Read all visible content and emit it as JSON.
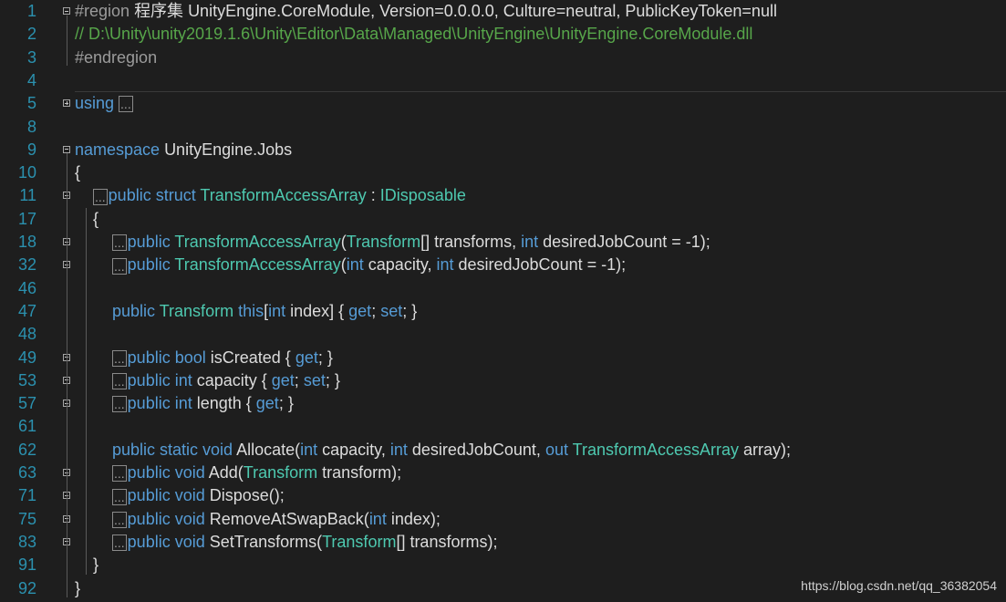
{
  "editor": {
    "lines": [
      {
        "n": "1",
        "fold": "minus",
        "indent": 0,
        "segs": [
          {
            "c": "pp",
            "t": "#region "
          },
          {
            "c": "tx",
            "t": "程序集 UnityEngine.CoreModule, Version=0.0.0.0, Culture=neutral, PublicKeyToken=null"
          }
        ]
      },
      {
        "n": "2",
        "indent": 0,
        "segs": [
          {
            "c": "cm",
            "t": "// D:\\Unity\\unity2019.1.6\\Unity\\Editor\\Data\\Managed\\UnityEngine\\UnityEngine.CoreModule.dll"
          }
        ]
      },
      {
        "n": "3",
        "indent": 0,
        "segs": [
          {
            "c": "pp",
            "t": "#endregion"
          }
        ]
      },
      {
        "n": "4",
        "indent": 0,
        "segs": []
      },
      {
        "n": "5",
        "fold": "plus",
        "indent": 0,
        "segs": [
          {
            "c": "kw",
            "t": "using "
          },
          {
            "c": "dots",
            "t": "..."
          }
        ]
      },
      {
        "n": "8",
        "indent": 0,
        "segs": []
      },
      {
        "n": "9",
        "fold": "minus",
        "indent": 0,
        "segs": [
          {
            "c": "kw",
            "t": "namespace "
          },
          {
            "c": "tx",
            "t": "UnityEngine.Jobs"
          }
        ]
      },
      {
        "n": "10",
        "indent": 0,
        "segs": [
          {
            "c": "tx",
            "t": "{"
          }
        ]
      },
      {
        "n": "11",
        "fold": "plus",
        "indent": 1,
        "segs": [
          {
            "c": "dots",
            "t": "..."
          },
          {
            "c": "kw",
            "t": "public struct "
          },
          {
            "c": "ty",
            "t": "TransformAccessArray"
          },
          {
            "c": "tx",
            "t": " : "
          },
          {
            "c": "ty",
            "t": "IDisposable"
          }
        ]
      },
      {
        "n": "17",
        "indent": 1,
        "segs": [
          {
            "c": "tx",
            "t": "{"
          }
        ]
      },
      {
        "n": "18",
        "fold": "plus",
        "indent": 2,
        "segs": [
          {
            "c": "dots",
            "t": "..."
          },
          {
            "c": "kw",
            "t": "public "
          },
          {
            "c": "ty",
            "t": "TransformAccessArray"
          },
          {
            "c": "tx",
            "t": "("
          },
          {
            "c": "ty",
            "t": "Transform"
          },
          {
            "c": "tx",
            "t": "[] transforms, "
          },
          {
            "c": "kw",
            "t": "int"
          },
          {
            "c": "tx",
            "t": " desiredJobCount = -1);"
          }
        ]
      },
      {
        "n": "32",
        "fold": "plus",
        "indent": 2,
        "segs": [
          {
            "c": "dots",
            "t": "..."
          },
          {
            "c": "kw",
            "t": "public "
          },
          {
            "c": "ty",
            "t": "TransformAccessArray"
          },
          {
            "c": "tx",
            "t": "("
          },
          {
            "c": "kw",
            "t": "int"
          },
          {
            "c": "tx",
            "t": " capacity, "
          },
          {
            "c": "kw",
            "t": "int"
          },
          {
            "c": "tx",
            "t": " desiredJobCount = -1);"
          }
        ]
      },
      {
        "n": "46",
        "indent": 0,
        "segs": []
      },
      {
        "n": "47",
        "indent": 2,
        "segs": [
          {
            "c": "kw",
            "t": "public "
          },
          {
            "c": "ty",
            "t": "Transform"
          },
          {
            "c": "kw",
            "t": " this"
          },
          {
            "c": "tx",
            "t": "["
          },
          {
            "c": "kw",
            "t": "int"
          },
          {
            "c": "tx",
            "t": " index] { "
          },
          {
            "c": "kw",
            "t": "get"
          },
          {
            "c": "tx",
            "t": "; "
          },
          {
            "c": "kw",
            "t": "set"
          },
          {
            "c": "tx",
            "t": "; }"
          }
        ]
      },
      {
        "n": "48",
        "indent": 0,
        "segs": []
      },
      {
        "n": "49",
        "fold": "plus",
        "indent": 2,
        "segs": [
          {
            "c": "dots",
            "t": "..."
          },
          {
            "c": "kw",
            "t": "public bool "
          },
          {
            "c": "tx",
            "t": "isCreated { "
          },
          {
            "c": "kw",
            "t": "get"
          },
          {
            "c": "tx",
            "t": "; }"
          }
        ]
      },
      {
        "n": "53",
        "fold": "plus",
        "indent": 2,
        "segs": [
          {
            "c": "dots",
            "t": "..."
          },
          {
            "c": "kw",
            "t": "public int "
          },
          {
            "c": "tx",
            "t": "capacity { "
          },
          {
            "c": "kw",
            "t": "get"
          },
          {
            "c": "tx",
            "t": "; "
          },
          {
            "c": "kw",
            "t": "set"
          },
          {
            "c": "tx",
            "t": "; }"
          }
        ]
      },
      {
        "n": "57",
        "fold": "plus",
        "indent": 2,
        "segs": [
          {
            "c": "dots",
            "t": "..."
          },
          {
            "c": "kw",
            "t": "public int "
          },
          {
            "c": "tx",
            "t": "length { "
          },
          {
            "c": "kw",
            "t": "get"
          },
          {
            "c": "tx",
            "t": "; }"
          }
        ]
      },
      {
        "n": "61",
        "indent": 0,
        "segs": []
      },
      {
        "n": "62",
        "indent": 2,
        "segs": [
          {
            "c": "kw",
            "t": "public static void "
          },
          {
            "c": "tx",
            "t": "Allocate("
          },
          {
            "c": "kw",
            "t": "int"
          },
          {
            "c": "tx",
            "t": " capacity, "
          },
          {
            "c": "kw",
            "t": "int"
          },
          {
            "c": "tx",
            "t": " desiredJobCount, "
          },
          {
            "c": "kw",
            "t": "out "
          },
          {
            "c": "ty",
            "t": "TransformAccessArray"
          },
          {
            "c": "tx",
            "t": " array);"
          }
        ]
      },
      {
        "n": "63",
        "fold": "plus",
        "indent": 2,
        "segs": [
          {
            "c": "dots",
            "t": "..."
          },
          {
            "c": "kw",
            "t": "public void "
          },
          {
            "c": "tx",
            "t": "Add("
          },
          {
            "c": "ty",
            "t": "Transform"
          },
          {
            "c": "tx",
            "t": " transform);"
          }
        ]
      },
      {
        "n": "71",
        "fold": "plus",
        "indent": 2,
        "segs": [
          {
            "c": "dots",
            "t": "..."
          },
          {
            "c": "kw",
            "t": "public void "
          },
          {
            "c": "tx",
            "t": "Dispose();"
          }
        ]
      },
      {
        "n": "75",
        "fold": "plus",
        "indent": 2,
        "segs": [
          {
            "c": "dots",
            "t": "..."
          },
          {
            "c": "kw",
            "t": "public void "
          },
          {
            "c": "tx",
            "t": "RemoveAtSwapBack("
          },
          {
            "c": "kw",
            "t": "int"
          },
          {
            "c": "tx",
            "t": " index);"
          }
        ]
      },
      {
        "n": "83",
        "fold": "plus",
        "indent": 2,
        "segs": [
          {
            "c": "dots",
            "t": "..."
          },
          {
            "c": "kw",
            "t": "public void "
          },
          {
            "c": "tx",
            "t": "SetTransforms("
          },
          {
            "c": "ty",
            "t": "Transform"
          },
          {
            "c": "tx",
            "t": "[] transforms);"
          }
        ]
      },
      {
        "n": "91",
        "indent": 1,
        "segs": [
          {
            "c": "tx",
            "t": "}"
          }
        ]
      },
      {
        "n": "92",
        "indent": 0,
        "segs": [
          {
            "c": "tx",
            "t": "}"
          }
        ]
      }
    ]
  },
  "colors": {
    "background": "#1e1e1e",
    "line_number": "#2b91af",
    "keyword": "#569cd6",
    "type": "#4ec9b0",
    "comment": "#57a64a",
    "preprocessor": "#9b9b9b",
    "text": "#dcdcdc"
  },
  "watermark": "https://blog.csdn.net/qq_36382054"
}
